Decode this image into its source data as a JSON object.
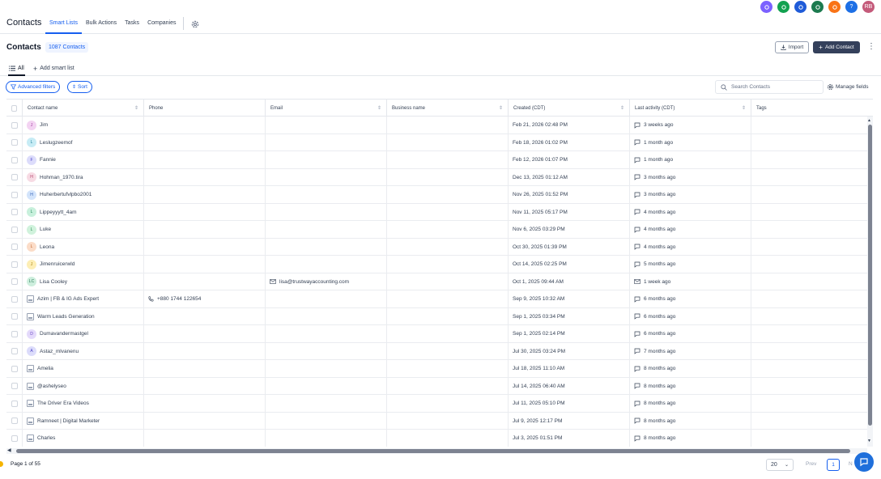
{
  "app": {
    "title": "Contacts"
  },
  "nav": {
    "items": [
      {
        "label": "Smart Lists",
        "active": true
      },
      {
        "label": "Bulk Actions",
        "active": false
      },
      {
        "label": "Tasks",
        "active": false
      },
      {
        "label": "Companies",
        "active": false
      }
    ]
  },
  "top_circles": [
    {
      "name": "apps-icon",
      "color": "#7b61ff",
      "text": ""
    },
    {
      "name": "phone-icon",
      "color": "#12a150",
      "text": ""
    },
    {
      "name": "link-icon",
      "color": "#1f5bd8",
      "text": ""
    },
    {
      "name": "megaphone-icon",
      "color": "#1c7a4f",
      "text": ""
    },
    {
      "name": "bell-icon",
      "color": "#f97316",
      "text": ""
    },
    {
      "name": "help-icon",
      "color": "#1d6fe5",
      "text": "?"
    },
    {
      "name": "avatar",
      "color": "#c45a7a",
      "text": "RB"
    }
  ],
  "header": {
    "title": "Contacts",
    "count": "1087 Contacts",
    "import_label": "Import",
    "add_label": "Add Contact"
  },
  "lists": {
    "all_label": "All",
    "add_label": "Add smart list"
  },
  "filters": {
    "advanced_label": "Advanced filters",
    "sort_label": "Sort",
    "search_placeholder": "Search Contacts",
    "manage_label": "Manage fields"
  },
  "columns": [
    "Contact name",
    "Phone",
    "Email",
    "Business name",
    "Created (CDT)",
    "Last activity (CDT)",
    "Tags"
  ],
  "colors": {
    "accent": "#155eef",
    "primary_button": "#34405b"
  },
  "rows": [
    {
      "initials": "J",
      "avatar_bg": "#f3d3f2",
      "avatar_fg": "#a23ea0",
      "name": "Jim",
      "phone": "",
      "email": "",
      "business": "",
      "created": "Feb 21, 2026 02:48 PM",
      "activity_icon": "chat",
      "activity": "3 weeks ago"
    },
    {
      "initials": "L",
      "avatar_bg": "#c7ecf5",
      "avatar_fg": "#1b7f9a",
      "name": "Leslugzeemof",
      "phone": "",
      "email": "",
      "business": "",
      "created": "Feb 18, 2026 01:02 PM",
      "activity_icon": "chat",
      "activity": "1 month ago"
    },
    {
      "initials": "F",
      "avatar_bg": "#dcdcfb",
      "avatar_fg": "#4f46c8",
      "name": "Fannie",
      "phone": "",
      "email": "",
      "business": "",
      "created": "Feb 12, 2026 01:07 PM",
      "activity_icon": "chat",
      "activity": "1 month ago"
    },
    {
      "initials": "H",
      "avatar_bg": "#f7dbe4",
      "avatar_fg": "#b43c66",
      "name": "Hohman_1970.tira",
      "phone": "",
      "email": "",
      "business": "",
      "created": "Dec 13, 2025 01:12 AM",
      "activity_icon": "chat",
      "activity": "3 months ago"
    },
    {
      "initials": "H",
      "avatar_bg": "#d3e4fb",
      "avatar_fg": "#2f5fb8",
      "name": "Huherbertufvlpbo2001",
      "phone": "",
      "email": "",
      "business": "",
      "created": "Nov 26, 2025 01:52 PM",
      "activity_icon": "chat",
      "activity": "3 months ago"
    },
    {
      "initials": "L",
      "avatar_bg": "#c8f0dc",
      "avatar_fg": "#21895a",
      "name": "Lippeyyytt_4am",
      "phone": "",
      "email": "",
      "business": "",
      "created": "Nov 11, 2025 05:17 PM",
      "activity_icon": "chat",
      "activity": "4 months ago"
    },
    {
      "initials": "L",
      "avatar_bg": "#d0f2dc",
      "avatar_fg": "#2a8a52",
      "name": "Luke",
      "phone": "",
      "email": "",
      "business": "",
      "created": "Nov 6, 2025 03:29 PM",
      "activity_icon": "chat",
      "activity": "4 months ago"
    },
    {
      "initials": "L",
      "avatar_bg": "#fbdcc8",
      "avatar_fg": "#c0622a",
      "name": "Leona",
      "phone": "",
      "email": "",
      "business": "",
      "created": "Oct 30, 2025 01:39 PM",
      "activity_icon": "chat",
      "activity": "4 months ago"
    },
    {
      "initials": "J",
      "avatar_bg": "#fdeeb5",
      "avatar_fg": "#a9820f",
      "name": "Jimenruicerwld",
      "phone": "",
      "email": "",
      "business": "",
      "created": "Oct 14, 2025 02:25 PM",
      "activity_icon": "chat",
      "activity": "5 months ago"
    },
    {
      "initials": "LC",
      "avatar_bg": "#cdeedd",
      "avatar_fg": "#2a7d57",
      "name": "Lisa Cooley",
      "phone": "",
      "email": "lisa@trustwayaccounting.com",
      "business": "",
      "created": "Oct 1, 2025 09:44 AM",
      "activity_icon": "mail",
      "activity": "1 week ago"
    },
    {
      "initials": "",
      "avatar_bg": "",
      "avatar_fg": "",
      "name": "Azim | FB & IG Ads Expert",
      "phone": "+880 1744 122654",
      "email": "",
      "business": "",
      "created": "Sep 9, 2025 10:32 AM",
      "activity_icon": "chat",
      "activity": "6 months ago"
    },
    {
      "initials": "",
      "avatar_bg": "",
      "avatar_fg": "",
      "name": "Warm Leads Generation",
      "phone": "",
      "email": "",
      "business": "",
      "created": "Sep 1, 2025 03:34 PM",
      "activity_icon": "chat",
      "activity": "6 months ago"
    },
    {
      "initials": "D",
      "avatar_bg": "#e4dafb",
      "avatar_fg": "#6a44c4",
      "name": "Dumavandermastgel",
      "phone": "",
      "email": "",
      "business": "",
      "created": "Sep 1, 2025 02:14 PM",
      "activity_icon": "chat",
      "activity": "6 months ago"
    },
    {
      "initials": "A",
      "avatar_bg": "#dcdcfb",
      "avatar_fg": "#4f46c8",
      "name": "Astaz_mlvanenu",
      "phone": "",
      "email": "",
      "business": "",
      "created": "Jul 30, 2025 03:24 PM",
      "activity_icon": "chat",
      "activity": "7 months ago"
    },
    {
      "initials": "",
      "avatar_bg": "",
      "avatar_fg": "",
      "name": "Amelia",
      "phone": "",
      "email": "",
      "business": "",
      "created": "Jul 18, 2025 11:10 AM",
      "activity_icon": "chat",
      "activity": "8 months ago"
    },
    {
      "initials": "",
      "avatar_bg": "",
      "avatar_fg": "",
      "name": "@ashelyseo",
      "phone": "",
      "email": "",
      "business": "",
      "created": "Jul 14, 2025 06:40 AM",
      "activity_icon": "chat",
      "activity": "8 months ago"
    },
    {
      "initials": "",
      "avatar_bg": "",
      "avatar_fg": "",
      "name": "The Driver Era Videos",
      "phone": "",
      "email": "",
      "business": "",
      "created": "Jul 11, 2025 05:10 PM",
      "activity_icon": "chat",
      "activity": "8 months ago"
    },
    {
      "initials": "",
      "avatar_bg": "",
      "avatar_fg": "",
      "name": "Ramneet | Digital Marketer",
      "phone": "",
      "email": "",
      "business": "",
      "created": "Jul 9, 2025 12:17 PM",
      "activity_icon": "chat",
      "activity": "8 months ago"
    },
    {
      "initials": "",
      "avatar_bg": "",
      "avatar_fg": "",
      "name": "Charles",
      "phone": "",
      "email": "",
      "business": "",
      "created": "Jul 3, 2025 01:51 PM",
      "activity_icon": "chat",
      "activity": "8 months ago"
    }
  ],
  "footer": {
    "page_label": "Page 1 of 55",
    "per_page": "20",
    "prev_label": "Prev",
    "page_number": "1",
    "next_label": "N"
  }
}
